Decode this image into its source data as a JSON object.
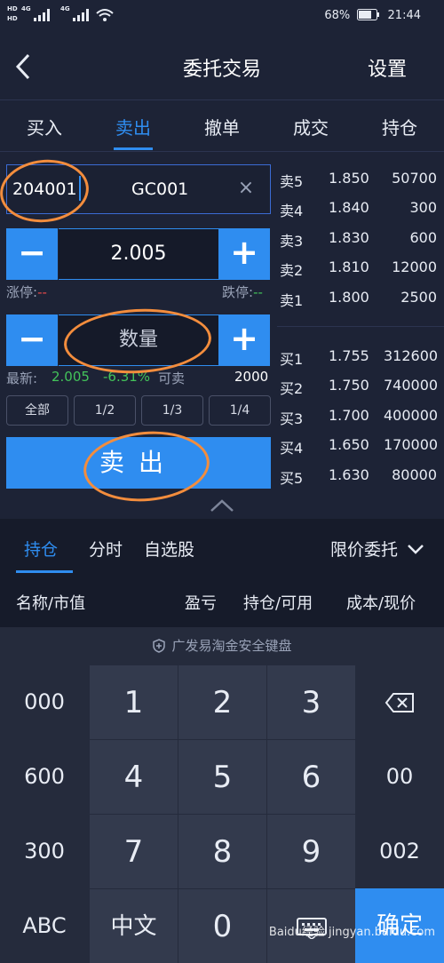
{
  "status_bar": {
    "hd1": "HD",
    "hd2": "HD",
    "net1": "4G",
    "net2": "4G",
    "battery": "68%",
    "time": "21:44"
  },
  "header": {
    "title": "委托交易",
    "settings": "设置"
  },
  "tabs": [
    "买入",
    "卖出",
    "撤单",
    "成交",
    "持仓"
  ],
  "order": {
    "code": "204001",
    "name": "GC001",
    "price": "2.005",
    "limit_up_label": "涨停:",
    "limit_up_value": "--",
    "limit_down_label": "跌停:",
    "limit_down_value": "--",
    "quantity_placeholder": "数量",
    "latest_label": "最新:",
    "latest_value": "2.005",
    "change_value": "-6.31%",
    "available_label": "可卖",
    "available_value": "2000",
    "fractions": [
      "全部",
      "1/2",
      "1/3",
      "1/4"
    ],
    "sell_button": "卖出"
  },
  "orderbook": {
    "asks": [
      {
        "label": "卖5",
        "price": "1.850",
        "volume": "50700"
      },
      {
        "label": "卖4",
        "price": "1.840",
        "volume": "300"
      },
      {
        "label": "卖3",
        "price": "1.830",
        "volume": "600"
      },
      {
        "label": "卖2",
        "price": "1.810",
        "volume": "12000"
      },
      {
        "label": "卖1",
        "price": "1.800",
        "volume": "2500"
      }
    ],
    "bids": [
      {
        "label": "买1",
        "price": "1.755",
        "volume": "312600"
      },
      {
        "label": "买2",
        "price": "1.750",
        "volume": "740000"
      },
      {
        "label": "买3",
        "price": "1.700",
        "volume": "400000"
      },
      {
        "label": "买4",
        "price": "1.650",
        "volume": "170000"
      },
      {
        "label": "买5",
        "price": "1.630",
        "volume": "80000"
      }
    ]
  },
  "bottom_panel": {
    "tabs": [
      "持仓",
      "分时",
      "自选股"
    ],
    "order_type": "限价委托",
    "columns": [
      "名称/市值",
      "盈亏",
      "持仓/可用",
      "成本/现价"
    ]
  },
  "keyboard": {
    "title": "广发易淘金安全键盘",
    "left_keys": [
      "000",
      "600",
      "300",
      "ABC"
    ],
    "num_rows": [
      [
        "1",
        "2",
        "3"
      ],
      [
        "4",
        "5",
        "6"
      ],
      [
        "7",
        "8",
        "9"
      ],
      [
        "中文",
        "0",
        ""
      ]
    ],
    "right_keys": [
      "",
      "00",
      "002",
      "确定"
    ]
  },
  "watermark": "Baidu经验 jingyan.baidu.com",
  "colors": {
    "accent": "#2f8df0",
    "price_green": "#43c35a",
    "volume_orange": "#f2a22a",
    "limit_red": "#e84a4a",
    "annotation_orange": "#f38d3d"
  }
}
